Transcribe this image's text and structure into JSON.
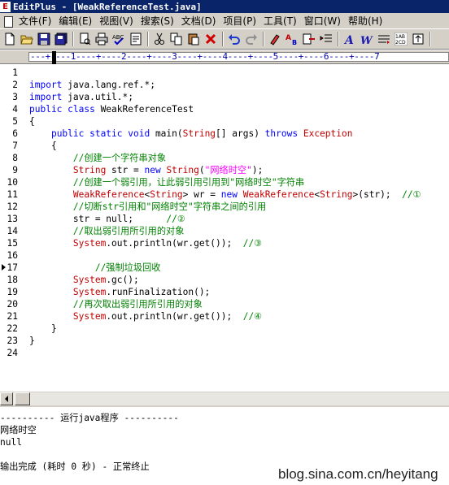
{
  "window": {
    "title": "EditPlus - [WeakReferenceTest.java]",
    "app_icon_glyph": "E"
  },
  "menu": {
    "items": [
      "文件(F)",
      "编辑(E)",
      "视图(V)",
      "搜索(S)",
      "文档(D)",
      "项目(P)",
      "工具(T)",
      "窗口(W)",
      "帮助(H)"
    ]
  },
  "toolbar": {
    "buttons": [
      "new-file",
      "open-file",
      "save",
      "save-all",
      "print-preview",
      "print",
      "spell-check",
      "word-wrap",
      "cut",
      "copy",
      "paste",
      "delete",
      "undo",
      "redo",
      "find",
      "replace",
      "copy-format",
      "indent",
      "font-bold",
      "font-italic",
      "toggle-wrap",
      "line-numbers",
      "spacing"
    ]
  },
  "ruler": {
    "text": "---+----1----+----2----+----3----+----4----+----5----+----6----+----7"
  },
  "editor": {
    "current_line": 17,
    "lines": [
      {
        "n": "1",
        "tokens": []
      },
      {
        "n": "2",
        "tokens": [
          {
            "c": "kw",
            "t": "import"
          },
          {
            "c": "pl",
            "t": " java.lang.ref.*;"
          }
        ]
      },
      {
        "n": "3",
        "tokens": [
          {
            "c": "kw",
            "t": "import"
          },
          {
            "c": "pl",
            "t": " java.util.*;"
          }
        ]
      },
      {
        "n": "4",
        "tokens": [
          {
            "c": "kw",
            "t": "public class"
          },
          {
            "c": "pl",
            "t": " WeakReferenceTest"
          }
        ]
      },
      {
        "n": "5",
        "tokens": [
          {
            "c": "pl",
            "t": "{"
          }
        ]
      },
      {
        "n": "6",
        "tokens": [
          {
            "c": "pl",
            "t": "    "
          },
          {
            "c": "kw",
            "t": "public static void"
          },
          {
            "c": "pl",
            "t": " main("
          },
          {
            "c": "ty",
            "t": "String"
          },
          {
            "c": "pl",
            "t": "[] args) "
          },
          {
            "c": "kw",
            "t": "throws"
          },
          {
            "c": "pl",
            "t": " "
          },
          {
            "c": "ty",
            "t": "Exception"
          }
        ]
      },
      {
        "n": "7",
        "tokens": [
          {
            "c": "pl",
            "t": "    {"
          }
        ]
      },
      {
        "n": "8",
        "tokens": [
          {
            "c": "pl",
            "t": "        "
          },
          {
            "c": "cm",
            "t": "//创建一个字符串对象"
          }
        ]
      },
      {
        "n": "9",
        "tokens": [
          {
            "c": "pl",
            "t": "        "
          },
          {
            "c": "ty",
            "t": "String"
          },
          {
            "c": "pl",
            "t": " str = "
          },
          {
            "c": "kw",
            "t": "new"
          },
          {
            "c": "pl",
            "t": " "
          },
          {
            "c": "ty",
            "t": "String"
          },
          {
            "c": "pl",
            "t": "("
          },
          {
            "c": "st",
            "t": "\"网络时空\""
          },
          {
            "c": "pl",
            "t": ");"
          }
        ]
      },
      {
        "n": "10",
        "tokens": [
          {
            "c": "pl",
            "t": "        "
          },
          {
            "c": "cm",
            "t": "//创建一个弱引用，让此弱引用引用到\"网络时空\"字符串"
          }
        ]
      },
      {
        "n": "11",
        "tokens": [
          {
            "c": "pl",
            "t": "        "
          },
          {
            "c": "ty",
            "t": "WeakReference"
          },
          {
            "c": "pl",
            "t": "<"
          },
          {
            "c": "ty",
            "t": "String"
          },
          {
            "c": "pl",
            "t": "> wr = "
          },
          {
            "c": "kw",
            "t": "new"
          },
          {
            "c": "pl",
            "t": " "
          },
          {
            "c": "ty",
            "t": "WeakReference"
          },
          {
            "c": "pl",
            "t": "<"
          },
          {
            "c": "ty",
            "t": "String"
          },
          {
            "c": "pl",
            "t": ">(str);  "
          },
          {
            "c": "cm",
            "t": "//①"
          }
        ]
      },
      {
        "n": "12",
        "tokens": [
          {
            "c": "pl",
            "t": "        "
          },
          {
            "c": "cm",
            "t": "//切断str引用和\"网络时空\"字符串之间的引用"
          }
        ]
      },
      {
        "n": "13",
        "tokens": [
          {
            "c": "pl",
            "t": "        str = null;      "
          },
          {
            "c": "cm",
            "t": "//②"
          }
        ]
      },
      {
        "n": "14",
        "tokens": [
          {
            "c": "pl",
            "t": "        "
          },
          {
            "c": "cm",
            "t": "//取出弱引用所引用的对象"
          }
        ]
      },
      {
        "n": "15",
        "tokens": [
          {
            "c": "pl",
            "t": "        "
          },
          {
            "c": "ty",
            "t": "System"
          },
          {
            "c": "pl",
            "t": ".out.println(wr.get());  "
          },
          {
            "c": "cm",
            "t": "//③"
          }
        ]
      },
      {
        "n": "16",
        "tokens": []
      },
      {
        "n": "17",
        "tokens": [
          {
            "c": "pl",
            "t": "            "
          },
          {
            "c": "cm",
            "t": "//强制垃圾回收"
          }
        ]
      },
      {
        "n": "18",
        "tokens": [
          {
            "c": "pl",
            "t": "        "
          },
          {
            "c": "ty",
            "t": "System"
          },
          {
            "c": "pl",
            "t": ".gc();"
          }
        ]
      },
      {
        "n": "19",
        "tokens": [
          {
            "c": "pl",
            "t": "        "
          },
          {
            "c": "ty",
            "t": "System"
          },
          {
            "c": "pl",
            "t": ".runFinalization();"
          }
        ]
      },
      {
        "n": "20",
        "tokens": [
          {
            "c": "pl",
            "t": "        "
          },
          {
            "c": "cm",
            "t": "//再次取出弱引用所引用的对象"
          }
        ]
      },
      {
        "n": "21",
        "tokens": [
          {
            "c": "pl",
            "t": "        "
          },
          {
            "c": "ty",
            "t": "System"
          },
          {
            "c": "pl",
            "t": ".out.println(wr.get());  "
          },
          {
            "c": "cm",
            "t": "//④"
          }
        ]
      },
      {
        "n": "22",
        "tokens": [
          {
            "c": "pl",
            "t": "    }"
          }
        ]
      },
      {
        "n": "23",
        "tokens": [
          {
            "c": "pl",
            "t": "}"
          }
        ]
      },
      {
        "n": "24",
        "tokens": []
      }
    ]
  },
  "output": {
    "lines": [
      "---------- 运行java程序 ----------",
      "网络时空",
      "null",
      "",
      "输出完成 (耗时 0 秒) - 正常终止"
    ]
  },
  "watermark": "blog.sina.com.cn/heyitang",
  "colors": {
    "keyword": "#0000ff",
    "type": "#c00000",
    "string": "#ff00ff",
    "comment": "#008000",
    "titlebar": "#0a246a",
    "chrome": "#d4d0c8"
  }
}
